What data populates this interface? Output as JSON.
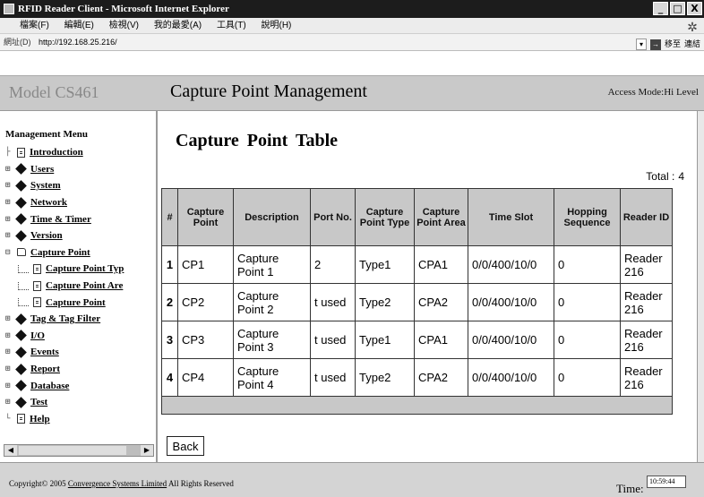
{
  "window": {
    "title": "RFID Reader Client - Microsoft Internet Explorer",
    "buttons": [
      "_",
      "□",
      "X"
    ]
  },
  "browser": {
    "menu": [
      "檔案(F)",
      "編輯(E)",
      "檢視(V)",
      "我的最愛(A)",
      "工具(T)",
      "說明(H)"
    ],
    "address_label": "網址(D)",
    "address_url": "http://192.168.25.216/",
    "go_label": "移至",
    "links_label": "連結"
  },
  "header": {
    "model": "Model CS461",
    "page_title": "Capture Point Management",
    "access": "Access Mode:Hi Level"
  },
  "sidebar": {
    "title": "Management Menu",
    "items": [
      {
        "label": "Introduction",
        "icon": "doc-icon"
      },
      {
        "label": "Users",
        "icon": "diamond-icon"
      },
      {
        "label": "System",
        "icon": "diamond-icon"
      },
      {
        "label": "Network",
        "icon": "diamond-icon"
      },
      {
        "label": "Time & Timer",
        "icon": "diamond-icon"
      },
      {
        "label": "Version",
        "icon": "diamond-icon"
      },
      {
        "label": "Capture Point",
        "icon": "folder-icon"
      },
      {
        "label": "Capture Point Typ",
        "icon": "doc-icon"
      },
      {
        "label": "Capture Point Are",
        "icon": "doc-icon"
      },
      {
        "label": "Capture Point",
        "icon": "doc-icon"
      },
      {
        "label": "Tag & Tag Filter",
        "icon": "diamond-icon"
      },
      {
        "label": "I/O",
        "icon": "diamond-icon"
      },
      {
        "label": "Events",
        "icon": "diamond-icon"
      },
      {
        "label": "Report",
        "icon": "diamond-icon"
      },
      {
        "label": "Database",
        "icon": "diamond-icon"
      },
      {
        "label": "Test",
        "icon": "diamond-icon"
      },
      {
        "label": "Help",
        "icon": "doc-icon"
      }
    ]
  },
  "main": {
    "table_title": "Capture Point Table",
    "total_label": "Total :",
    "total_value": "4",
    "columns": [
      "#",
      "Capture Point",
      "Description",
      "Port No.",
      "Capture Point Type",
      "Capture Point Area",
      "Time Slot",
      "Hopping Sequence",
      "Reader ID"
    ],
    "rows": [
      [
        "1",
        "CP1",
        "Capture Point 1",
        "2",
        "Type1",
        "CPA1",
        "0/0/400/10/0",
        "0",
        "Reader 216"
      ],
      [
        "2",
        "CP2",
        "Capture Point 2",
        "t used",
        "Type2",
        "CPA2",
        "0/0/400/10/0",
        "0",
        "Reader 216"
      ],
      [
        "3",
        "CP3",
        "Capture Point 3",
        "t used",
        "Type1",
        "CPA1",
        "0/0/400/10/0",
        "0",
        "Reader 216"
      ],
      [
        "4",
        "CP4",
        "Capture Point 4",
        "t used",
        "Type2",
        "CPA2",
        "0/0/400/10/0",
        "0",
        "Reader 216"
      ]
    ],
    "back_label": "Back"
  },
  "footer": {
    "copyright_prefix": "Copyright© 2005",
    "copyright_link": "Convergence Systems Limited",
    "copyright_suffix": "All Rights Reserved",
    "time_label": "Time:",
    "time_value": "10:59:44"
  }
}
